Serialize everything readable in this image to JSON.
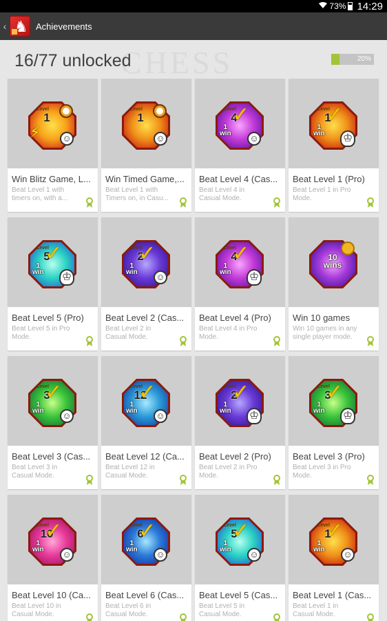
{
  "status_bar": {
    "battery": "73%",
    "time": "14:29"
  },
  "action_bar": {
    "title": "Achievements"
  },
  "header": {
    "unlocked_text": "16/77 unlocked",
    "progress_label": "20%",
    "progress_value": 0.2,
    "watermark": "CHESS"
  },
  "colors": {
    "accent": "#a2c43a",
    "action_bar": "#3a3a3a",
    "card_image_bg": "#cecece"
  },
  "achievements": [
    {
      "title": "Win Blitz Game, L...",
      "description": "Beat Level 1 with timers on, with a...",
      "badge": {
        "level": "1",
        "type": "blitz",
        "grad": "radial-gradient(circle at 50% 50%,#ffe04a 0%,#f7a21a 45%,#d3301a 85%)"
      }
    },
    {
      "title": "Win Timed Game,...",
      "description": "Beat Level 1 with Timers on, in Casu...",
      "badge": {
        "level": "1",
        "type": "timed",
        "grad": "radial-gradient(circle at 50% 50%,#ffe04a 0%,#f0901a 45%,#c92a10 85%)"
      }
    },
    {
      "title": "Beat Level 4 (Cas...",
      "description": "Beat Level 4 in Casual Mode.",
      "badge": {
        "level": "4",
        "type": "casual",
        "grad": "radial-gradient(circle at 50% 50%,#f8a6ff 0%,#c43ad8 45%,#6a1aa8 85%)"
      }
    },
    {
      "title": "Beat Level 1 (Pro)",
      "description": "Beat Level 1 in Pro Mode.",
      "badge": {
        "level": "1",
        "type": "pro",
        "grad": "radial-gradient(circle at 50% 50%,#ffe04a 0%,#f0901a 45%,#c92a10 85%)"
      }
    },
    {
      "title": "Beat Level 5 (Pro)",
      "description": "Beat Level 5 in Pro Mode.",
      "badge": {
        "level": "5",
        "type": "pro",
        "grad": "radial-gradient(circle at 50% 50%,#b8fff0 0%,#2ad3c3 45%,#2a6ad3 85%)"
      }
    },
    {
      "title": "Beat Level 2 (Cas...",
      "description": "Beat Level 2 in Casual Mode.",
      "badge": {
        "level": "2",
        "type": "casual",
        "grad": "radial-gradient(circle at 50% 50%,#b6a8ff 0%,#6a3ad8 45%,#3a1a98 85%)"
      }
    },
    {
      "title": "Beat Level 4 (Pro)",
      "description": "Beat Level 4 in Pro Mode.",
      "badge": {
        "level": "4",
        "type": "pro",
        "grad": "radial-gradient(circle at 50% 50%,#f8a6ff 0%,#c43ad8 45%,#6a1aa8 85%)"
      }
    },
    {
      "title": "Win 10 games",
      "description": "Win 10 games in any single player mode.",
      "badge": {
        "level": "",
        "type": "wins10",
        "grad": "radial-gradient(circle at 50% 50%,#f8a6ff 0%,#a63ad8 45%,#4a1aa8 85%)"
      }
    },
    {
      "title": "Beat Level 3 (Cas...",
      "description": "Beat Level 3 in Casual Mode.",
      "badge": {
        "level": "3",
        "type": "casual",
        "grad": "radial-gradient(circle at 50% 50%,#c8ff8a 0%,#3ac43a 45%,#1a7a3a 85%)"
      }
    },
    {
      "title": "Beat Level 12 (Ca...",
      "description": "Beat Level 12 in Casual Mode.",
      "badge": {
        "level": "12",
        "type": "casual",
        "grad": "radial-gradient(circle at 50% 50%,#a8e8ff 0%,#2a9ad8 45%,#1a4aa8 85%)"
      }
    },
    {
      "title": "Beat Level 2 (Pro)",
      "description": "Beat Level 2 in Pro Mode.",
      "badge": {
        "level": "2",
        "type": "pro",
        "grad": "radial-gradient(circle at 50% 50%,#b6a8ff 0%,#6a3ad8 45%,#3a1a98 85%)"
      }
    },
    {
      "title": "Beat Level 3 (Pro)",
      "description": "Beat Level 3 in Pro Mode.",
      "badge": {
        "level": "3",
        "type": "pro",
        "grad": "radial-gradient(circle at 50% 50%,#c8ff8a 0%,#3ac43a 45%,#1a7a3a 85%)"
      }
    },
    {
      "title": "Beat Level 10 (Ca...",
      "description": "Beat Level 10 in Casual Mode.",
      "badge": {
        "level": "10",
        "type": "casual",
        "grad": "radial-gradient(circle at 50% 50%,#ffa8d8 0%,#e83a9a 45%,#a81a6a 85%)"
      }
    },
    {
      "title": "Beat Level 6 (Cas...",
      "description": "Beat Level 6 in Casual Mode.",
      "badge": {
        "level": "6",
        "type": "casual",
        "grad": "radial-gradient(circle at 50% 50%,#a8e8ff 0%,#2a7ad8 45%,#1a3aa8 85%)"
      }
    },
    {
      "title": "Beat Level 5 (Cas...",
      "description": "Beat Level 5 in Casual Mode.",
      "badge": {
        "level": "5",
        "type": "casual",
        "grad": "radial-gradient(circle at 50% 50%,#b8fff0 0%,#2ad3c3 45%,#2a6ad3 85%)"
      }
    },
    {
      "title": "Beat Level 1 (Cas...",
      "description": "Beat Level 1 in Casual Mode.",
      "badge": {
        "level": "1",
        "type": "casual",
        "grad": "radial-gradient(circle at 50% 50%,#ffe04a 0%,#f0901a 45%,#c92a10 85%)"
      }
    }
  ],
  "badge_text": {
    "level_word": "Level",
    "one_win": "1\nwin",
    "ten_wins": "10\nwins"
  }
}
